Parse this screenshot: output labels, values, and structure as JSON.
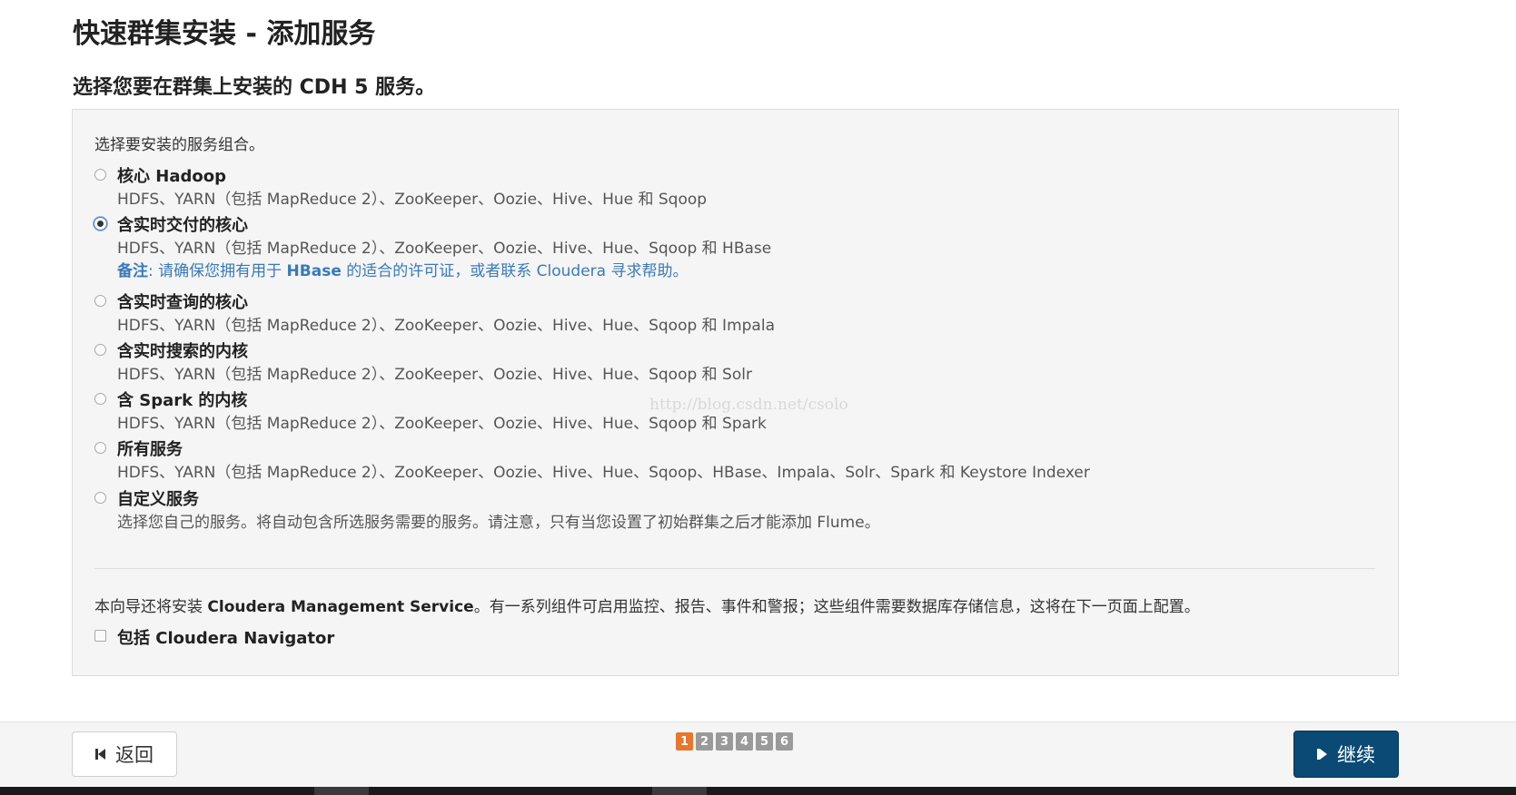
{
  "page": {
    "title": "快速群集安装 - 添加服务",
    "subtitle": "选择您要在群集上安装的 CDH 5 服务。"
  },
  "panel": {
    "intro": "选择要安装的服务组合。",
    "options": [
      {
        "label": "核心 Hadoop",
        "description": "HDFS、YARN（包括 MapReduce 2）、ZooKeeper、Oozie、Hive、Hue 和 Sqoop",
        "checked": false
      },
      {
        "label": "含实时交付的核心",
        "description": "HDFS、YARN（包括 MapReduce 2）、ZooKeeper、Oozie、Hive、Hue、Sqoop 和 HBase",
        "checked": true,
        "note_prefix": "备注",
        "note_text1": ": 请确保您拥有用于 ",
        "note_bold": "HBase",
        "note_text2": " 的适合的许可证，或者联系 Cloudera 寻求帮助。"
      },
      {
        "label": "含实时查询的核心",
        "description": "HDFS、YARN（包括 MapReduce 2）、ZooKeeper、Oozie、Hive、Hue、Sqoop 和 Impala",
        "checked": false
      },
      {
        "label": "含实时搜索的内核",
        "description": "HDFS、YARN（包括 MapReduce 2）、ZooKeeper、Oozie、Hive、Hue、Sqoop 和 Solr",
        "checked": false
      },
      {
        "label": "含 Spark 的内核",
        "description": "HDFS、YARN（包括 MapReduce 2）、ZooKeeper、Oozie、Hive、Hue、Sqoop 和 Spark",
        "checked": false
      },
      {
        "label": "所有服务",
        "description": "HDFS、YARN（包括 MapReduce 2）、ZooKeeper、Oozie、Hive、Hue、Sqoop、HBase、Impala、Solr、Spark 和 Keystore Indexer",
        "checked": false
      },
      {
        "label": "自定义服务",
        "description": "选择您自己的服务。将自动包含所选服务需要的服务。请注意，只有当您设置了初始群集之后才能添加 Flume。",
        "checked": false
      }
    ],
    "mgmt_prefix": "本向导还将安装 ",
    "mgmt_bold": "Cloudera Management Service",
    "mgmt_suffix": "。有一系列组件可启用监控、报告、事件和警报；这些组件需要数据库存储信息，这将在下一页面上配置。",
    "navigator_label": "包括 Cloudera Navigator",
    "navigator_checked": false
  },
  "watermark": "http://blog.csdn.net/csolo",
  "footer": {
    "back_label": "返回",
    "next_label": "继续",
    "steps": [
      "1",
      "2",
      "3",
      "4",
      "5",
      "6"
    ],
    "active_step": 1
  },
  "colors": {
    "primary_button": "#0b4a75",
    "active_step": "#e8772e",
    "note_link": "#3a7ab8"
  }
}
